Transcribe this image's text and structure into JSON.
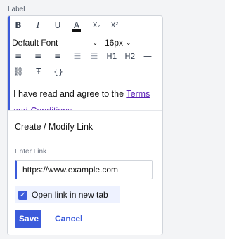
{
  "field": {
    "label": "Label"
  },
  "toolbar": {
    "row1": [
      {
        "name": "bold-button",
        "glyph": "B"
      },
      {
        "name": "italic-button",
        "glyph": "I"
      },
      {
        "name": "underline-button",
        "glyph": "U"
      },
      {
        "name": "font-color-button",
        "glyph": "A"
      },
      {
        "name": "subscript-button",
        "glyph": "X₂"
      },
      {
        "name": "superscript-button",
        "glyph": "X²"
      }
    ],
    "font_select": "Default Font",
    "size_select": "16px",
    "row3": [
      {
        "name": "align-left-button",
        "glyph": "≡"
      },
      {
        "name": "align-center-button",
        "glyph": "≡"
      },
      {
        "name": "align-right-button",
        "glyph": "≡"
      },
      {
        "name": "bullet-list-button",
        "glyph": "☰"
      },
      {
        "name": "numbered-list-button",
        "glyph": "☰"
      },
      {
        "name": "heading1-button",
        "glyph": "H1"
      },
      {
        "name": "heading2-button",
        "glyph": "H2"
      },
      {
        "name": "horizontal-rule-button",
        "glyph": "—"
      }
    ],
    "row4": [
      {
        "name": "link-button",
        "glyph": "⛓"
      },
      {
        "name": "clear-format-button",
        "glyph": "Ŧ"
      },
      {
        "name": "code-button",
        "glyph": "{}"
      }
    ]
  },
  "content": {
    "text_before": "I have read and agree to the ",
    "link_text": "Terms and Conditions"
  },
  "link_popup": {
    "title": "Create / Modify Link",
    "enter_label": "Enter Link",
    "url_value": "https://www.example.com",
    "new_tab_label": "Open link in new tab",
    "new_tab_checked": true,
    "save_label": "Save",
    "cancel_label": "Cancel"
  },
  "colors": {
    "accent": "#3b5bdb",
    "link": "#5b21b6"
  }
}
